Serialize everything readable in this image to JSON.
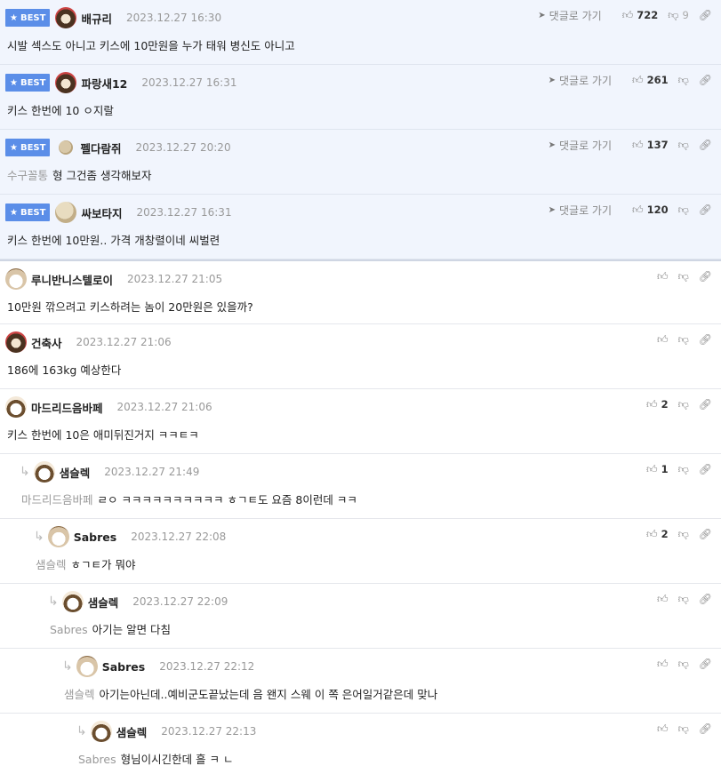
{
  "best_label": "BEST",
  "goto_label": "댓글로 가기",
  "comments": [
    {
      "best": true,
      "author": "배규리",
      "date": "2023.12.27 16:30",
      "mention": "",
      "text": "시발 섹스도 아니고 키스에 10만원을 누가 태워 병신도 아니고",
      "up": "722",
      "down": "9",
      "avatar": "bear-icon",
      "depth": 0
    },
    {
      "best": true,
      "author": "파랑새12",
      "date": "2023.12.27 16:31",
      "mention": "",
      "text": "키스 한번에 10 ㅇ지랄",
      "up": "261",
      "down": "",
      "avatar": "bear-icon",
      "depth": 0
    },
    {
      "best": true,
      "author": "펠다람쥐",
      "date": "2023.12.27 20:20",
      "mention": "수구꼴통",
      "text": "형 그건좀 생각해보자",
      "up": "137",
      "down": "",
      "avatar": "dot-icon",
      "depth": 0
    },
    {
      "best": true,
      "author": "싸보타지",
      "date": "2023.12.27 16:31",
      "mention": "",
      "text": "키스 한번에 10만원.. 가격 개창렬이네 씨벌련",
      "up": "120",
      "down": "",
      "avatar": "rock-icon",
      "depth": 0
    },
    {
      "best": false,
      "author": "루니반니스텔로이",
      "date": "2023.12.27 21:05",
      "mention": "",
      "text": "10만원 깎으려고 키스하려는 놈이 20만원은 있을까?",
      "up": "",
      "down": "",
      "avatar": "puppy-icon",
      "depth": 0
    },
    {
      "best": false,
      "author": "건축사",
      "date": "2023.12.27 21:06",
      "mention": "",
      "text": "186에 163kg 예상한다",
      "up": "",
      "down": "",
      "avatar": "bear-icon",
      "depth": 0
    },
    {
      "best": false,
      "author": "마드리드음바페",
      "date": "2023.12.27 21:06",
      "mention": "",
      "text": "키스 한번에 10은 애미뒤진거지 ㅋㅋㅌㅋ",
      "up": "2",
      "down": "",
      "avatar": "fox-icon",
      "depth": 0
    },
    {
      "best": false,
      "author": "샘슬렉",
      "date": "2023.12.27 21:49",
      "mention": "마드리드음바페",
      "text": "ㄹㅇ ㅋㅋㅋㅋㅋㅋㅋㅋㅋㅋ ㅎㄱㅌ도 요즘 8이런데 ㅋㅋ",
      "up": "1",
      "down": "",
      "avatar": "fox-icon",
      "depth": 1
    },
    {
      "best": false,
      "author": "Sabres",
      "date": "2023.12.27 22:08",
      "mention": "샘슬렉",
      "text": "ㅎㄱㅌ가 뭐야",
      "up": "2",
      "down": "",
      "avatar": "puppy-icon",
      "depth": 2
    },
    {
      "best": false,
      "author": "샘슬렉",
      "date": "2023.12.27 22:09",
      "mention": "Sabres",
      "text": "아기는 알면 다침",
      "up": "",
      "down": "",
      "avatar": "fox-icon",
      "depth": 3
    },
    {
      "best": false,
      "author": "Sabres",
      "date": "2023.12.27 22:12",
      "mention": "샘슬렉",
      "text": "아기는아닌데..예비군도끝났는데 음 왠지 스웨 이 쪽 은어일거같은데 맞나",
      "up": "",
      "down": "",
      "avatar": "puppy-icon",
      "depth": 4
    },
    {
      "best": false,
      "author": "샘슬렉",
      "date": "2023.12.27 22:13",
      "mention": "Sabres",
      "text": "형님이시긴한데 흘 ㅋ ㄴ",
      "up": "",
      "down": "",
      "avatar": "fox-icon",
      "depth": 5
    }
  ]
}
